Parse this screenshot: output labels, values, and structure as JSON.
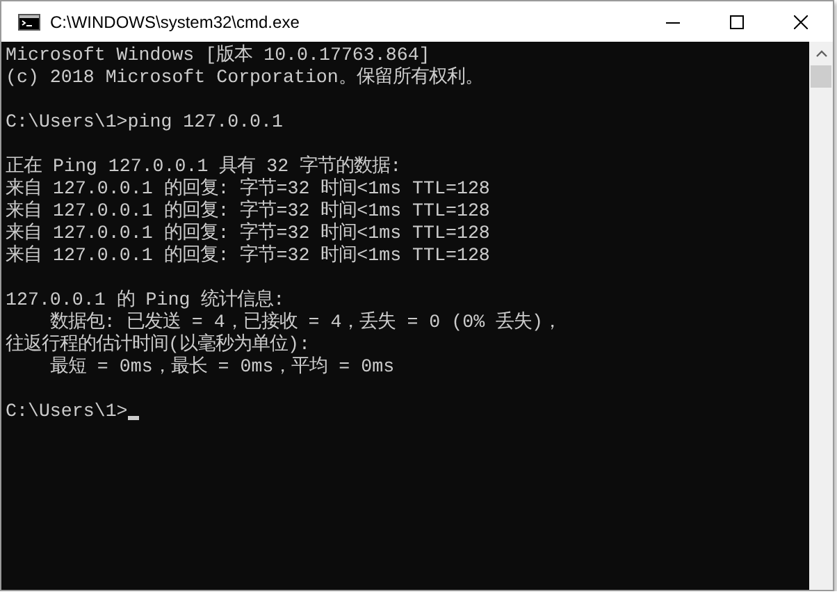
{
  "window": {
    "title": "C:\\WINDOWS\\system32\\cmd.exe"
  },
  "console": {
    "blocks": [
      {
        "lines": [
          "Microsoft Windows [版本 10.0.17763.864]",
          "(c) 2018 Microsoft Corporation。保留所有权利。"
        ]
      },
      {
        "lines": [
          "C:\\Users\\1>ping 127.0.0.1"
        ]
      },
      {
        "lines": [
          "正在 Ping 127.0.0.1 具有 32 字节的数据:",
          "来自 127.0.0.1 的回复: 字节=32 时间<1ms TTL=128",
          "来自 127.0.0.1 的回复: 字节=32 时间<1ms TTL=128",
          "来自 127.0.0.1 的回复: 字节=32 时间<1ms TTL=128",
          "来自 127.0.0.1 的回复: 字节=32 时间<1ms TTL=128"
        ]
      },
      {
        "lines": [
          "127.0.0.1 的 Ping 统计信息:",
          "    数据包: 已发送 = 4，已接收 = 4，丢失 = 0 (0% 丢失)，",
          "往返行程的估计时间(以毫秒为单位):",
          "    最短 = 0ms，最长 = 0ms，平均 = 0ms"
        ]
      },
      {
        "lines": [
          "C:\\Users\\1>"
        ]
      }
    ]
  }
}
